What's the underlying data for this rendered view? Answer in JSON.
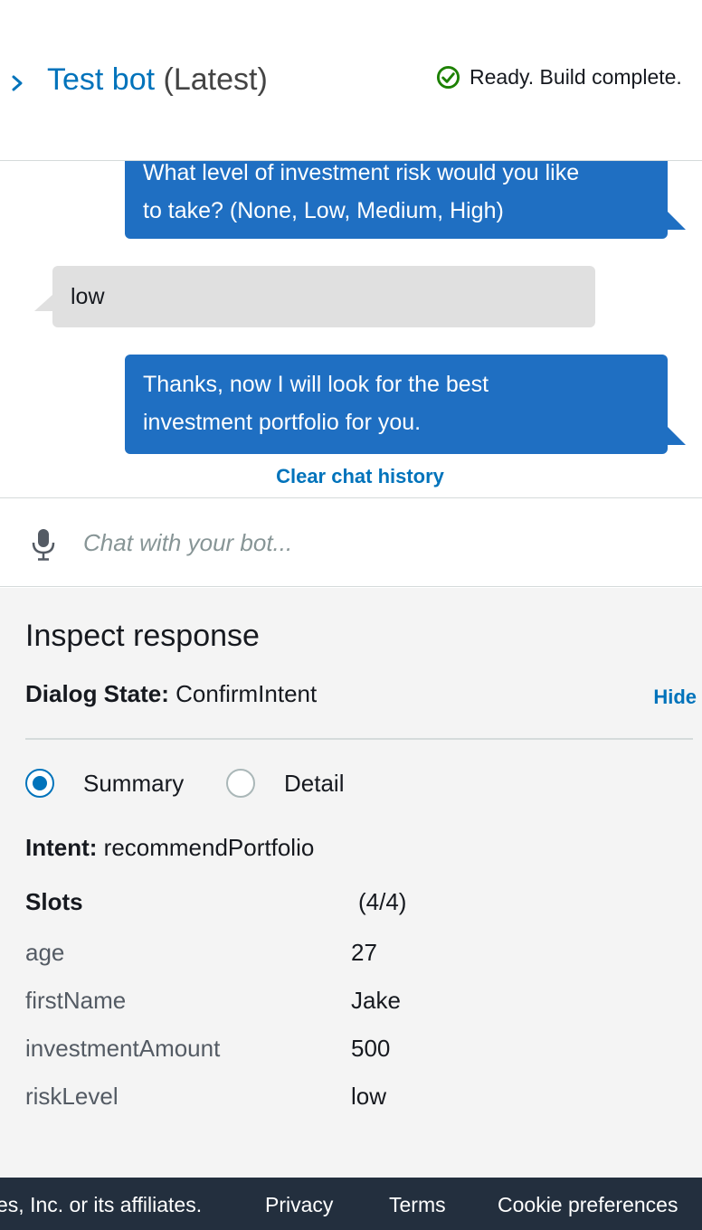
{
  "header": {
    "title_link": "Test bot",
    "title_version": "(Latest)",
    "status_text": "Ready. Build complete.",
    "status_icon": "check-circle-icon",
    "status_color": "#1d8102"
  },
  "chat": {
    "messages": [
      {
        "from": "bot",
        "text_line1": "What level of investment risk would you like",
        "text_line2": "to take? (None, Low, Medium, High)"
      },
      {
        "from": "user",
        "text": "low"
      },
      {
        "from": "bot",
        "text_line1": "Thanks, now I will look for the best",
        "text_line2": "investment portfolio for you."
      }
    ],
    "clear_history": "Clear chat history",
    "input_placeholder": "Chat with your bot..."
  },
  "inspect": {
    "title": "Inspect response",
    "dialog_state_label": "Dialog State:",
    "dialog_state_value": "ConfirmIntent",
    "hide_link": "Hide",
    "view_options": [
      "Summary",
      "Detail"
    ],
    "selected_view": "Summary",
    "intent_label": "Intent:",
    "intent_value": "recommendPortfolio",
    "slots_label": "Slots",
    "slots_count": "(4/4)",
    "slots": [
      {
        "name": "age",
        "value": "27"
      },
      {
        "name": "firstName",
        "value": "Jake"
      },
      {
        "name": "investmentAmount",
        "value": "500"
      },
      {
        "name": "riskLevel",
        "value": "low"
      }
    ]
  },
  "footer": {
    "copyright": "es, Inc. or its affiliates.",
    "privacy": "Privacy",
    "terms": "Terms",
    "cookies": "Cookie preferences"
  },
  "colors": {
    "accent": "#0073bb",
    "bot_bubble": "#1f6fc2",
    "user_bubble": "#e0e0e0",
    "footer_bg": "#232f3e"
  }
}
